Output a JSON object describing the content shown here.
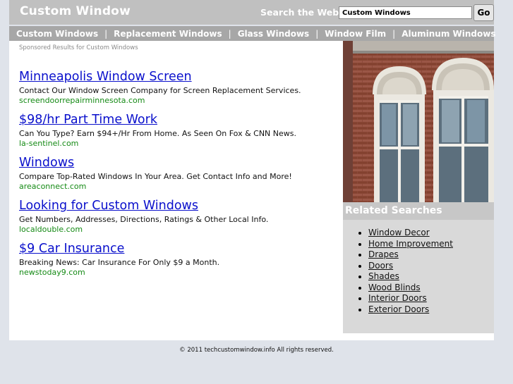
{
  "header": {
    "site_title": "Custom Window",
    "search_label": "Search the Web:",
    "search_value": "Custom Windows",
    "go_label": "Go"
  },
  "nav": {
    "items": [
      "Custom Windows",
      "Replacement Windows",
      "Glass Windows",
      "Window Film",
      "Aluminum Windows"
    ],
    "separator": "|"
  },
  "main": {
    "sponsored_label": "Sponsored Results for Custom Windows",
    "ads": [
      {
        "title": "Minneapolis Window Screen",
        "desc": "Contact Our Window Screen Company for Screen Replacement Services.",
        "url": "screendoorrepairminnesota.com"
      },
      {
        "title": "$98/hr Part Time Work",
        "desc": "Can You Type? Earn $94+/Hr From Home. As Seen On Fox & CNN News.",
        "url": "la-sentinel.com"
      },
      {
        "title": "Windows",
        "desc": "Compare Top-Rated Windows In Your Area. Get Contact Info and More!",
        "url": "areaconnect.com"
      },
      {
        "title": "Looking for Custom Windows",
        "desc": "Get Numbers, Addresses, Directions, Ratings & Other Local Info.",
        "url": "localdouble.com"
      },
      {
        "title": "$9 Car Insurance",
        "desc": "Breaking News: Car Insurance For Only $9 a Month.",
        "url": "newstoday9.com"
      }
    ]
  },
  "sidebar": {
    "related_title": "Related Searches",
    "related": [
      "Window Decor",
      "Home Improvement",
      "Drapes",
      "Doors",
      "Shades",
      "Wood Blinds",
      "Interior Doors",
      "Exterior Doors"
    ]
  },
  "footer": {
    "copyright": "© 2011 techcustomwindow.info All rights reserved."
  },
  "colors": {
    "header_bg": "#c0c0c0",
    "nav_bg": "#a7a7a7",
    "ad_title": "#0a10cc",
    "ad_url": "#158a15",
    "sidebar_bg": "#d9d9d9",
    "page_bg": "#dfe3ea"
  }
}
